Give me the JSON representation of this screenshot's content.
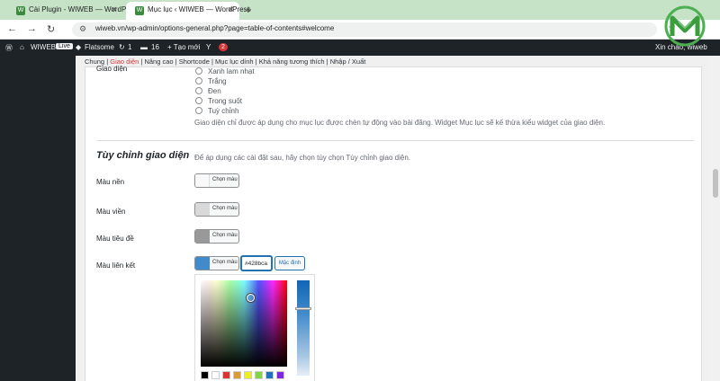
{
  "browser": {
    "tabs": [
      {
        "title": "Cài Plugin - WIWEB — WordPres",
        "active": false
      },
      {
        "title": "Mục lục ‹ WIWEB — WordPress",
        "active": true
      }
    ],
    "url": "wiweb.vn/wp-admin/options-general.php?page=table-of-contents#welcome"
  },
  "adminbar": {
    "site_name": "WIWEB",
    "live_label": "Live",
    "theme": "Flatsome",
    "updates_count": "1",
    "comments_count": "16",
    "new_label": "+ Tạo mới",
    "yoast_badge": "2",
    "greeting": "Xin chào, wiweb"
  },
  "subnav": {
    "items": [
      "Chung",
      "Giao diện",
      "Nâng cao",
      "Shortcode",
      "Mục lục dính",
      "Khả năng tương thích",
      "Nhập / Xuất"
    ],
    "current": "Giao diện"
  },
  "theme_options": {
    "label_fragment": "Giao diện",
    "options": [
      "Xanh lam nhạt",
      "Trắng",
      "Đen",
      "Trong suốt",
      "Tuỳ chỉnh"
    ],
    "description": "Giao diện chỉ được áp dụng cho mục lục được chèn tự động vào bài đăng. Widget Mục lục sẽ kế thừa kiểu widget của giao diện."
  },
  "custom_theme": {
    "title": "Tùy chỉnh giao diện",
    "description": "Để áp dụng các cài đặt sau, hãy chọn tùy chọn Tùy chỉnh giao diện.",
    "fields": [
      {
        "label": "Màu nền",
        "button_label": "Chọn màu",
        "color": "#f9f9f9"
      },
      {
        "label": "Màu viền",
        "button_label": "Chọn màu",
        "color": "#d9d9d9"
      },
      {
        "label": "Màu tiêu đề",
        "button_label": "Chọn màu",
        "color": "#999999"
      },
      {
        "label": "Màu liên kết",
        "button_label": "Chọn màu",
        "color": "#428bca"
      }
    ],
    "hex_value": "#428bca",
    "default_button": "Mặc định"
  },
  "colors": {
    "accent": "#2271b1",
    "adminbar": "#1d2327",
    "tab_strip": "#c6e3c8",
    "palette": [
      "#000000",
      "#ffffff",
      "#dd3333",
      "#dd9933",
      "#eeee22",
      "#81d742",
      "#1e73be",
      "#8224e3"
    ]
  }
}
